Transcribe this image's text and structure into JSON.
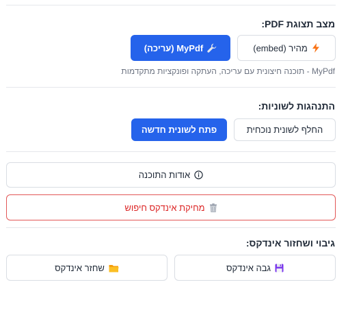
{
  "pdf_mode": {
    "title": "מצב תצוגת PDF:",
    "fast_button": "מהיר (embed)",
    "mypdf_button": "MyPdf (עריכה)",
    "description": "MyPdf - תוכנה חיצונית עם עריכה, העתקה ופונקציות מתקדמות"
  },
  "tab_behavior": {
    "title": "התנהגות לשוניות:",
    "replace_button": "החלף לשונית נוכחית",
    "new_tab_button": "פתח לשונית חדשה"
  },
  "about_button": "אודות התוכנה",
  "delete_index_button": "מחיקת אינדקס חיפוש",
  "backup": {
    "title": "גיבוי ושחזור אינדקס:",
    "backup_button": "גבה אינדקס",
    "restore_button": "שחזר אינדקס"
  },
  "colors": {
    "primary": "#2563eb",
    "danger": "#dc2626"
  },
  "icons": {
    "fast": "lightning-icon",
    "mypdf": "wrench-icon",
    "about": "info-icon",
    "delete": "trash-icon",
    "backup": "floppy-disk-icon",
    "restore": "folder-icon"
  }
}
